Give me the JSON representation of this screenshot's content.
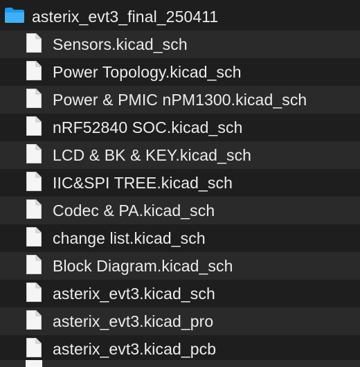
{
  "folder": {
    "name": "asterix_evt3_final_250411",
    "icon": "folder-icon",
    "color": "#1a9af0"
  },
  "files": [
    {
      "name": "Sensors.kicad_sch",
      "icon": "document-icon"
    },
    {
      "name": "Power Topology.kicad_sch",
      "icon": "document-icon"
    },
    {
      "name": "Power & PMIC nPM1300.kicad_sch",
      "icon": "document-icon"
    },
    {
      "name": "nRF52840 SOC.kicad_sch",
      "icon": "document-icon"
    },
    {
      "name": "LCD & BK & KEY.kicad_sch",
      "icon": "document-icon"
    },
    {
      "name": "IIC&SPI TREE.kicad_sch",
      "icon": "document-icon"
    },
    {
      "name": "Codec & PA.kicad_sch",
      "icon": "document-icon"
    },
    {
      "name": "change list.kicad_sch",
      "icon": "document-icon"
    },
    {
      "name": "Block Diagram.kicad_sch",
      "icon": "document-icon"
    },
    {
      "name": "asterix_evt3.kicad_sch",
      "icon": "document-icon"
    },
    {
      "name": "asterix_evt3.kicad_pro",
      "icon": "document-icon"
    },
    {
      "name": "asterix_evt3.kicad_pcb",
      "icon": "document-icon"
    }
  ],
  "colors": {
    "background": "#1e1e1e",
    "row_alt": "#2a2a2a",
    "text": "#ececec",
    "file_icon": "#f5f5f5"
  }
}
